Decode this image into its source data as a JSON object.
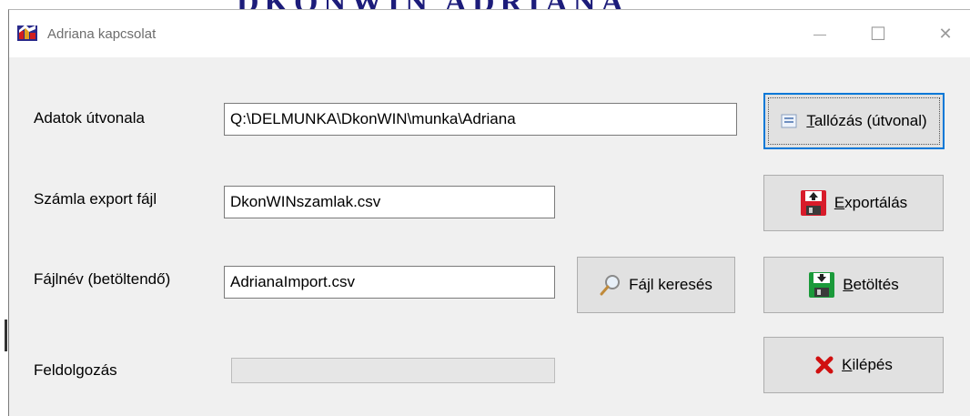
{
  "window": {
    "title": "Adriana kapcsolat",
    "controls": {
      "minimize": "—",
      "maximize": "☐",
      "close": "✕"
    }
  },
  "form": {
    "path": {
      "label": "Adatok útvonala",
      "value": "Q:\\DELMUNKA\\DkonWIN\\munka\\Adriana"
    },
    "export": {
      "label": "Számla export fájl",
      "value": "DkonWINszamlak.csv"
    },
    "import": {
      "label": "Fájlnév (betöltendő)",
      "value": "AdrianaImport.csv"
    },
    "progress": {
      "label": "Feldolgozás",
      "value": 0
    }
  },
  "buttons": {
    "browse": {
      "accel": "T",
      "rest": "allózás (útvonal)",
      "icon": "folder-browse-icon"
    },
    "export": {
      "accel": "E",
      "rest": "xportálás",
      "icon": "floppy-export-icon",
      "color": "#d81b2a"
    },
    "find_file": {
      "label": "Fájl keresés",
      "icon": "magnifier-icon"
    },
    "load": {
      "accel": "B",
      "rest": "etöltés",
      "icon": "floppy-load-icon",
      "color": "#1a9a3a"
    },
    "exit": {
      "accel": "K",
      "rest": "ilépés",
      "icon": "red-x-icon",
      "color": "#d01010"
    }
  },
  "background_text": "DKONWIN ADRIANA"
}
